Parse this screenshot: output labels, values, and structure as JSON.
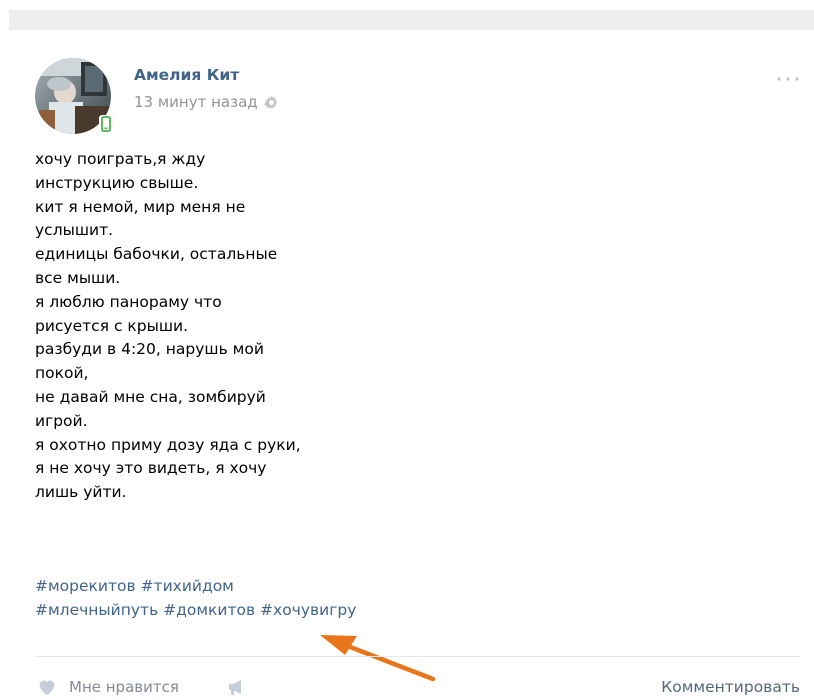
{
  "post": {
    "author": "Амелия Кит",
    "time": "13 минут назад",
    "text_lines": [
      "хочу поиграть,я жду",
      "инструкцию свыше.",
      "кит я немой, мир меня не",
      "услышит.",
      "единицы бабочки, остальные",
      "все мыши.",
      "я люблю панораму что",
      "рисуется с крыши.",
      "разбуди в 4:20, нарушь мой",
      "покой,",
      "не давай мне сна, зомбируй",
      "игрой.",
      "я охотно приму дозу яда с руки,",
      "я не хочу это видеть, я хочу",
      "лишь уйти."
    ],
    "hashtags": {
      "line1": [
        "#морекитов",
        "#тихийдом"
      ],
      "line2": [
        "#млечныйпуть",
        "#домкитов",
        "#хочувигру"
      ]
    }
  },
  "actions": {
    "like_label": "Мне нравится",
    "comment_label": "Комментировать"
  },
  "colors": {
    "link": "#42648b",
    "muted": "#939393",
    "annotation_arrow": "#e8751a"
  },
  "icons": [
    "gear-icon",
    "more-icon",
    "mobile-icon",
    "heart-icon",
    "share-icon",
    "arrow-annotation"
  ]
}
